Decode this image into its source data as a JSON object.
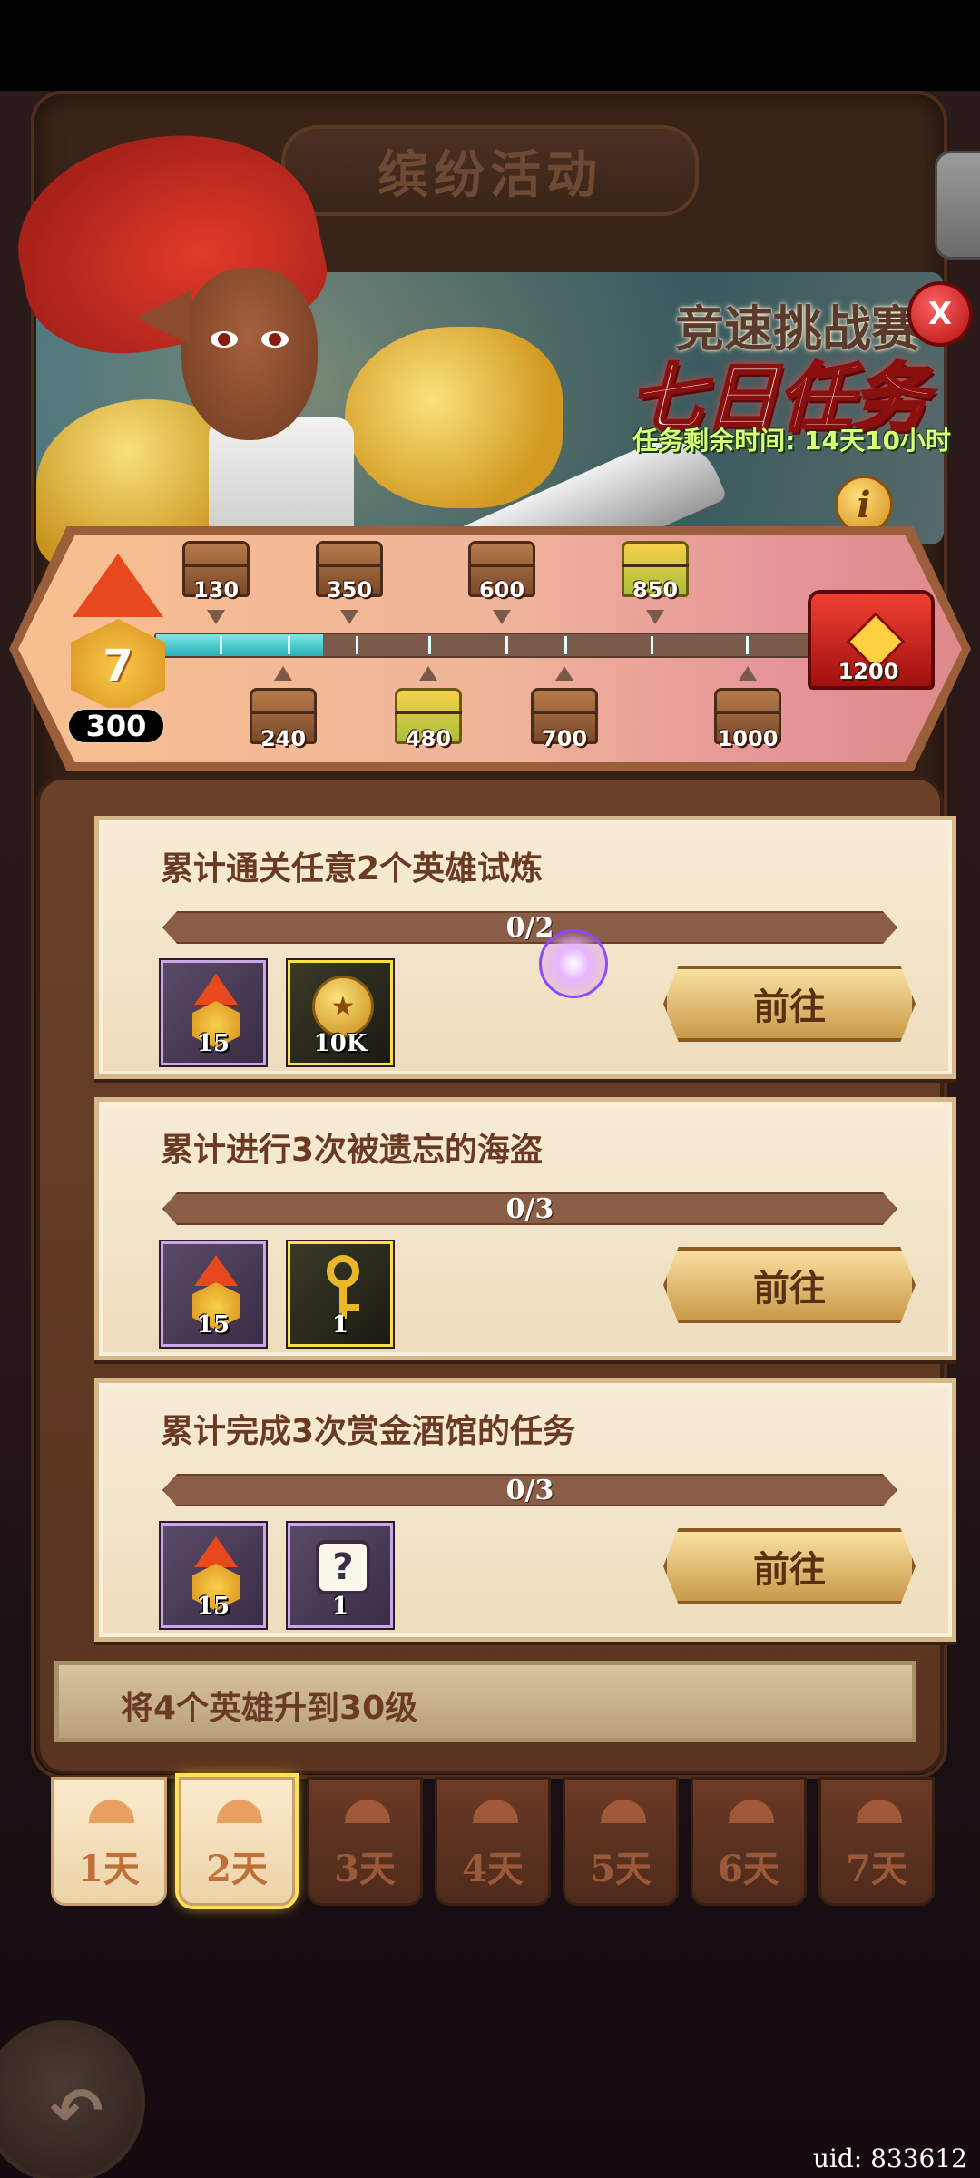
{
  "header": {
    "title": "缤纷活动"
  },
  "banner": {
    "event_title": "竞速挑战赛",
    "event_subtitle": "七日任务",
    "time_remaining": "任务剩余时间: 14天10小时"
  },
  "progress": {
    "level": "7",
    "points": "300",
    "current_value": 300,
    "max_value": 1200,
    "milestones_top": [
      "130",
      "350",
      "600",
      "850"
    ],
    "milestones_bottom": [
      "240",
      "480",
      "700",
      "1000"
    ],
    "final_milestone": "1200"
  },
  "tasks": [
    {
      "title": "累计通关任意2个英雄试炼",
      "progress": "0/2",
      "rewards": [
        {
          "icon": "medal-icon",
          "qty": "15"
        },
        {
          "icon": "gold-coin-icon",
          "qty": "10K"
        }
      ],
      "button": "前往"
    },
    {
      "title": "累计进行3次被遗忘的海盗",
      "progress": "0/3",
      "rewards": [
        {
          "icon": "medal-icon",
          "qty": "15"
        },
        {
          "icon": "key-icon",
          "qty": "1"
        }
      ],
      "button": "前往"
    },
    {
      "title": "累计完成3次赏金酒馆的任务",
      "progress": "0/3",
      "rewards": [
        {
          "icon": "medal-icon",
          "qty": "15"
        },
        {
          "icon": "mystery-box-icon",
          "qty": "1"
        }
      ],
      "button": "前往"
    },
    {
      "title": "将4个英雄升到30级"
    }
  ],
  "days": [
    "1天",
    "2天",
    "3天",
    "4天",
    "5天",
    "6天",
    "7天"
  ],
  "selected_day": "2天",
  "footer": {
    "uid": "uid: 833612"
  },
  "colors": {
    "accent_red": "#e8481e",
    "progress_teal": "#2ab0b8",
    "card_bg": "#f7ecd6"
  }
}
